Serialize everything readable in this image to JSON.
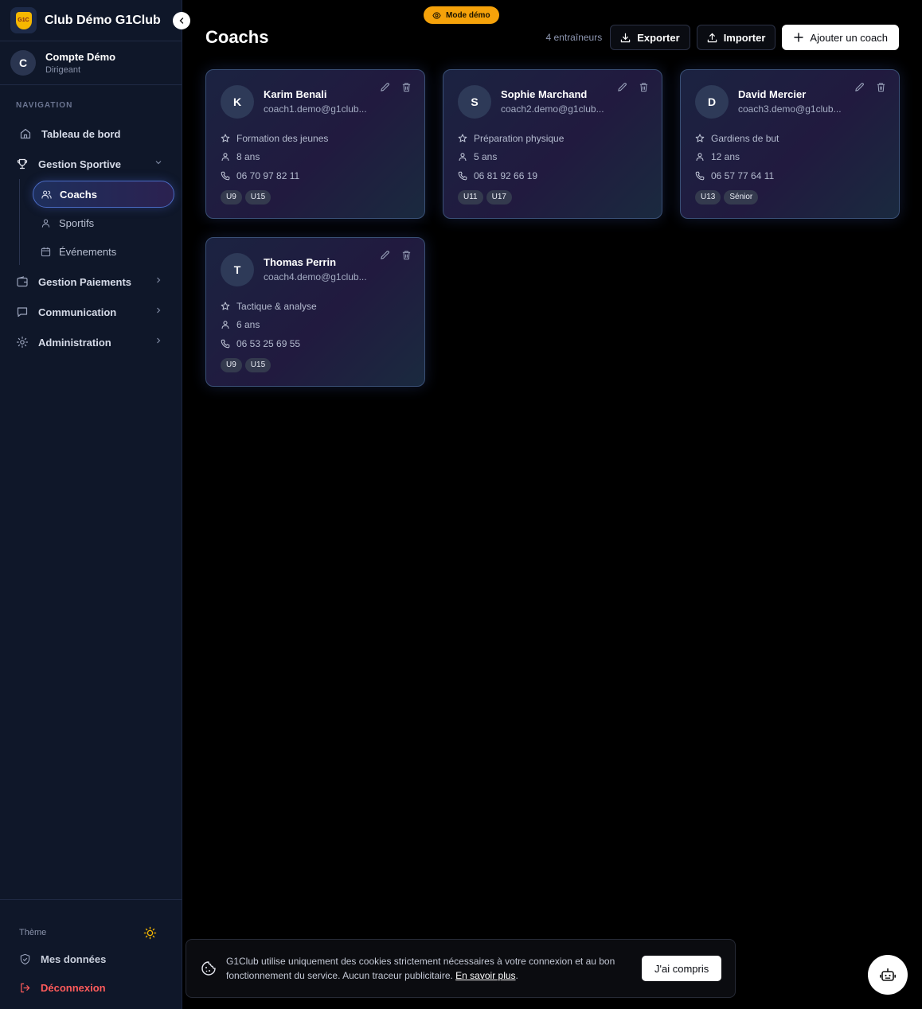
{
  "brand": {
    "name": "Club Démo G1Club",
    "logo_text": "G1C"
  },
  "account": {
    "initial": "C",
    "name": "Compte Démo",
    "role": "Dirigeant"
  },
  "nav": {
    "heading": "NAVIGATION",
    "dashboard": "Tableau de bord",
    "sport": "Gestion Sportive",
    "sub": {
      "coachs": "Coachs",
      "sportifs": "Sportifs",
      "events": "Événements"
    },
    "payments": "Gestion Paiements",
    "communication": "Communication",
    "admin": "Administration"
  },
  "bottom": {
    "theme": "Thème",
    "data": "Mes données",
    "logout": "Déconnexion"
  },
  "demo_badge": "Mode démo",
  "page": {
    "title": "Coachs",
    "count": "4 entraîneurs",
    "export": "Exporter",
    "import": "Importer",
    "add": "Ajouter un coach"
  },
  "coaches": [
    {
      "initial": "K",
      "name": "Karim Benali",
      "email": "coach1.demo@g1club...",
      "specialty": "Formation des jeunes",
      "experience": "8 ans",
      "phone": "06 70 97 82 11",
      "tags": [
        "U9",
        "U15"
      ]
    },
    {
      "initial": "S",
      "name": "Sophie Marchand",
      "email": "coach2.demo@g1club...",
      "specialty": "Préparation physique",
      "experience": "5 ans",
      "phone": "06 81 92 66 19",
      "tags": [
        "U11",
        "U17"
      ]
    },
    {
      "initial": "D",
      "name": "David Mercier",
      "email": "coach3.demo@g1club...",
      "specialty": "Gardiens de but",
      "experience": "12 ans",
      "phone": "06 57 77 64 11",
      "tags": [
        "U13",
        "Sénior"
      ]
    },
    {
      "initial": "T",
      "name": "Thomas Perrin",
      "email": "coach4.demo@g1club...",
      "specialty": "Tactique & analyse",
      "experience": "6 ans",
      "phone": "06 53 25 69 55",
      "tags": [
        "U9",
        "U15"
      ]
    }
  ],
  "cookie": {
    "text": "G1Club utilise uniquement des cookies strictement nécessaires à votre connexion et au bon fonctionnement du service. Aucun traceur publicitaire.",
    "link": "En savoir plus",
    "accept": "J'ai compris"
  },
  "colors": {
    "accent": "#f5a20a",
    "logout": "#ff5b5b",
    "sidebar_bg": "#0f1729"
  }
}
